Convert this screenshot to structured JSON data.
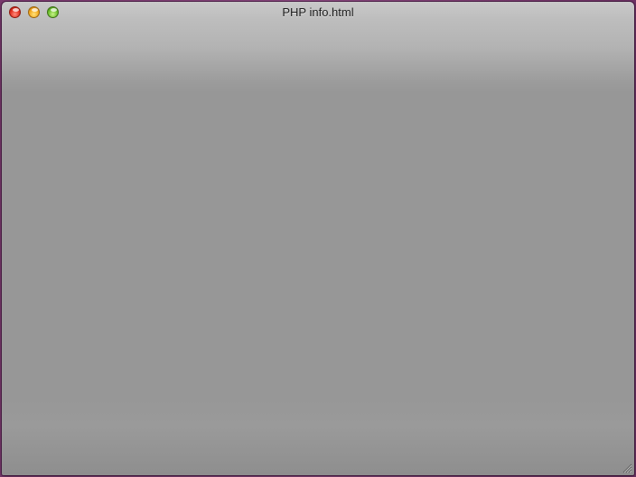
{
  "window": {
    "title": "PHP info.html"
  },
  "controls": {
    "close_color": "#e1301f",
    "minimize_color": "#f2a81c",
    "zoom_color": "#6cbf2b"
  },
  "icons": {
    "close": "close-button",
    "minimize": "minimize-button",
    "zoom": "zoom-button",
    "resize": "resize-grip-icon"
  }
}
